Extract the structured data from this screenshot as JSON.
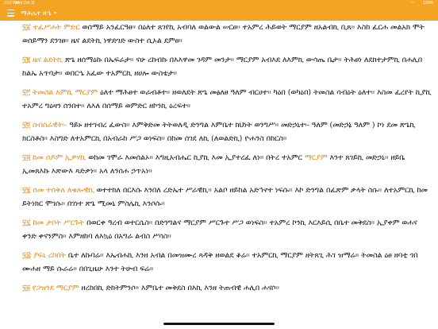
{
  "status_bar": {
    "time": "2:53 PM",
    "date": "Wed Oct 11",
    "battery": "100%",
    "wifi": "wifi"
  },
  "header": {
    "title": "ማሕሌተ ጽጌ",
    "caret": "▾",
    "menu_icon": "hamburger-menu-icon"
  },
  "colors": {
    "accent": "#f3a423",
    "highlight": "#e8891a"
  },
  "verses": [
    {
      "number": "፶፩",
      "highlight": "ተፈሥሐት ምድር",
      "text": " ወሰማይ አንፈርዓፀ፡፡ በዕለተ ጸገየኪ አብባለ ወልውል ሠርፀ፡፡ ተአምረ ሕይወት ማርያም ዘአልብኪ ቢጸ፡፡ እስከ ፈርሐ መልአክ ሞት ወሰይማን ደንገፀ፡፡ ዜና ልደትኪ ነዋድገድ ውስተ ሲኦል ደምፀ፡፡"
    },
    {
      "number": "፶፪",
      "highlight": "ዜና ልደትኪ",
      "text": " ጽጌ ዘሰማዕኩ በኤፍራታ፡፡ ናሁ ረከብኩ በእእዋመ ገዳም መንታ፡፡ ማርያም አብእደ ለእምኪ ውሳጤ ቤታ፡፡ ትሕፀነ ለደክተታምኪ በሐሊበ ከልኤ አጥባታ፡፡ ወበርኄ አፈው ተአምርኪ ዘሀሎ ውስቴታ፡፡"
    },
    {
      "number": "፶፫",
      "highlight": "ትመስል እምኪ ማርያም",
      "text": " ዕለተ ማሕፀተ ወራብቶተ፡፡ ዘወለደት ጽጌ መፅለፀ ዓለም ብርሀተ፡፡ ካዕበ (ወካዕበ) ትመስል ሳብዕት ዕለተ፡፡ እስመ ፈረየት ኪያኪ ተአምረ ግዕዛን ሰንበተ፡፡ ለእለ በሰማይ ወምድር ዘኮንኪ ዕረፍተ፡፡"
    },
    {
      "number": "፶፬",
      "highlight": "ሰብሰራዊት፡-",
      "text": " ዓይኑ ዘተገብረ ፈውስ፡፡ እምቅድመ ትትወለዲ ድንግል እምቤተ ክህነት ወንግሥ፡፡ መድኃኒተ፡- ዓለም (መድኃኔ ዓለም ) ኮነ ደመ ጽጌኪ ክርስቶስ፡፡ እስግድ ለተአምርኪ በአብራከ ሥጋ ወነፍስ፡፡ በከመ ሰገደ ለኪ (ለወልድኪ) ዮሐንስ በከርስ፡፡"
    },
    {
      "number": "፶፭",
      "highlight": "ከመ ሰዶም ኢዎሃኪ",
      "text": " ወከመ ገሞራ እመሰልኦ፡፡ እግዚአብሔር ኪያኪ እመ ኢያተረፈ ለነ፡፡ በትረ ተአምር ማርያም እንተ ጸገይኪ መድኃኒ፡፡ ዘይቤ ኢመጸእኩ እጽውእ ጻድቃነ፡፡ አላ ለንሰሐ ኃጥአነ፡፡",
      "second_highlight": "ማርያም"
    },
    {
      "number": "፶፮",
      "highlight": "ሰመ ተሰቅለ ለቁሎዊኪ",
      "text": " ወተተክለ በርእሱ እንበለ ረድኤተ ሥራዊኪ፡፡ አልቦ ዘይከል አድኅኖተ ነፍሱ፡፡ እኮ ድንግል በፈጽም ቃላት ስሱ፡፡ ለተአምርኪ ከመ ይትነክር ሞገሱ፡፡ በገነተ ጽጌ ሚመኒ ምስሌኪ እንሶሱ፡፡"
    },
    {
      "number": "፶፯",
      "highlight": "ከመ ታቦት ሥርጉት",
      "text": " በወርቀ ዓረብ ወተርሴስ፡፡ በድንግልና ማርያም ሥርጉተ ሥጋ ወነፍስ፡፡ ተአምረ ኮንኪ እርእይሲ በቤተ መቅደስ፡፡ ኢያቀም ወሐና ቀንድ ቀናንምስ፡፡ እምዘከባ ለእኳዕ በአግራ ልብስ ሥሳስ፡፡"
    },
    {
      "number": "፶፰",
      "highlight": "ያፍኒ ረከበት",
      "text": " ቤተ ለኩባሬ፡፡ እኤብሐኪ እንዘ አብል በመዝሙረ ጻዳቅ ዘወልደ ቆሬ፡፡ ተአምርኪ ማርያም ዘትጸጊ ሕገ ዝማሬ፡፡ ትመስል ዕፀ ዘባቲ ጎበ ሙሐዘ ማይ ሱራሬ፡፡ በበጊዜሁ እንተ ትሁብ ፍሬ፡፡"
    },
    {
      "number": "፶፱",
      "highlight": "የጋዝንደ ማርያም",
      "text": " ዘረከበኪ ድከትምንሶ፡፡ እምቤተ መቅደስ በእኪ እንዘ ትጠብዊ ሐሊበ ሐናሶ፡፡"
    }
  ]
}
